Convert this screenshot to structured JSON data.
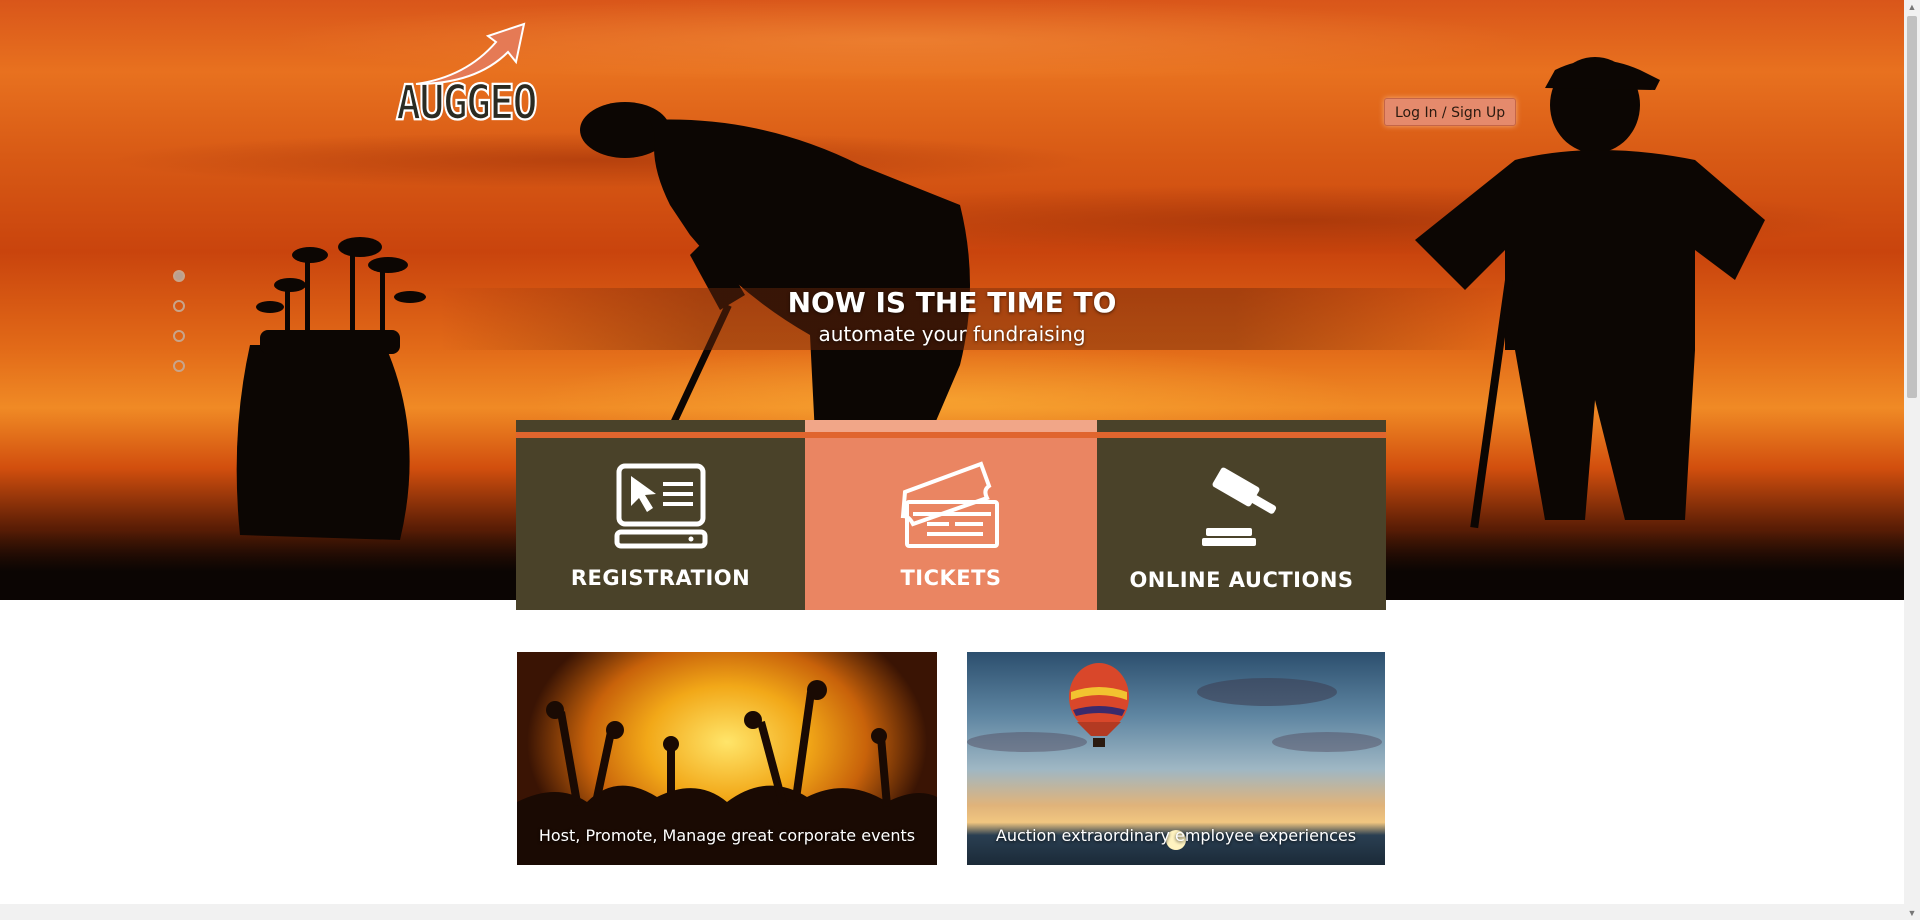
{
  "header": {
    "logo_text": "AUGGEO",
    "login_label": "Log In / Sign Up"
  },
  "carousel": {
    "slide_count": 4,
    "active_index": 0
  },
  "hero": {
    "headline": "NOW IS THE TIME TO",
    "subheadline": "automate your fundraising"
  },
  "features": [
    {
      "label": "REGISTRATION",
      "icon": "computer-cursor-icon"
    },
    {
      "label": "TICKETS",
      "icon": "tickets-icon"
    },
    {
      "label": "ONLINE AUCTIONS",
      "icon": "gavel-icon"
    }
  ],
  "promos": [
    {
      "caption": "Host, Promote, Manage great corporate events"
    },
    {
      "caption": "Auction extraordinary employee experiences"
    }
  ],
  "colors": {
    "tile_dark": "#4a4229",
    "tile_accent": "#ea8562",
    "accent_orange": "#e0652e"
  }
}
